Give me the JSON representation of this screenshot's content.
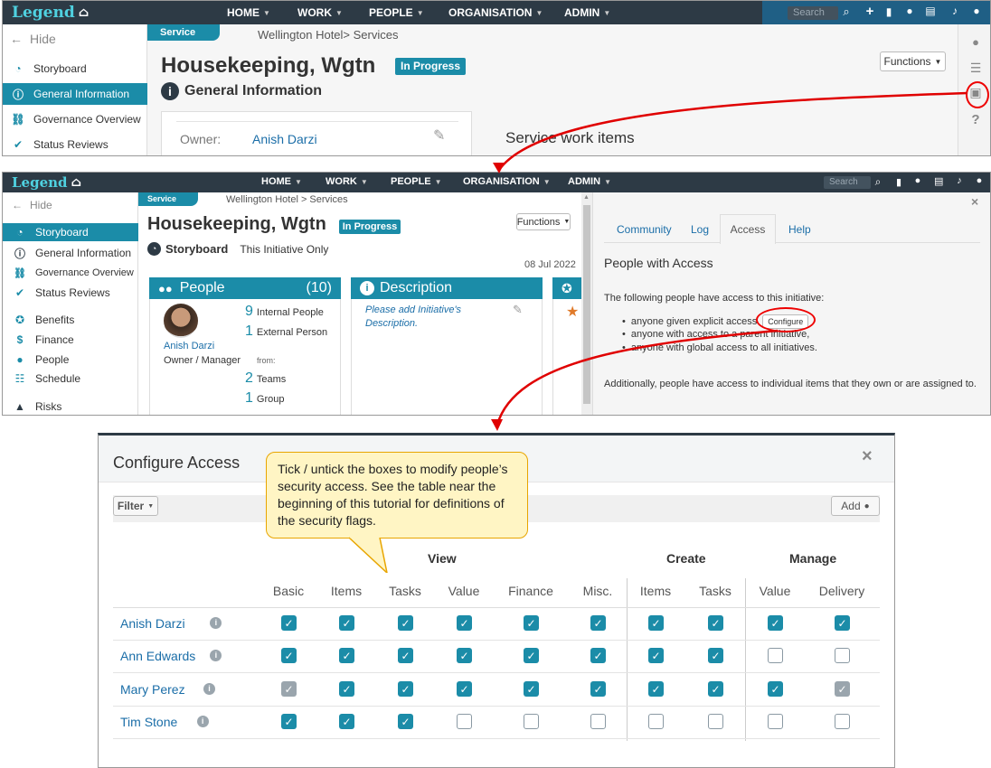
{
  "nav": {
    "brand": "Legend",
    "items": [
      "HOME",
      "WORK",
      "PEOPLE",
      "ORGANISATION",
      "ADMIN"
    ],
    "search_placeholder": "Search"
  },
  "side": {
    "hide": "Hide",
    "items": [
      {
        "label": "Storyboard",
        "icon": "dashboard-icon"
      },
      {
        "label": "General Information",
        "icon": "info-icon"
      },
      {
        "label": "Governance Overview",
        "icon": "governance-icon"
      },
      {
        "label": "Status Reviews",
        "icon": "check-icon"
      },
      {
        "label": "Benefits",
        "icon": "ribbon-icon"
      },
      {
        "label": "Finance",
        "icon": "finance-icon"
      },
      {
        "label": "People",
        "icon": "people-icon"
      },
      {
        "label": "Schedule",
        "icon": "schedule-icon"
      },
      {
        "label": "Risks",
        "icon": "warning-icon"
      }
    ]
  },
  "page": {
    "service_tab": "Service",
    "breadcrumb1": "Wellington Hotel> Services",
    "breadcrumb2": "Wellington Hotel > Services",
    "title": "Housekeeping, Wgtn",
    "status": "In Progress",
    "functions": "Functions",
    "section": "General Information",
    "owner_label": "Owner:",
    "owner_name": "Anish Darzi",
    "work_items": "Service work items",
    "storyboard": "Storyboard",
    "scope": "This Initiative Only",
    "date": "08 Jul 2022"
  },
  "people_card": {
    "title": "People",
    "count": "(10)",
    "person_name": "Anish Darzi",
    "person_role": "Owner / Manager",
    "internal_num": "9",
    "internal_label": "Internal People",
    "external_num": "1",
    "external_label": "External Person",
    "from_label": "from:",
    "teams_num": "2",
    "teams_label": "Teams",
    "group_num": "1",
    "group_label": "Group"
  },
  "desc_card": {
    "title": "Description",
    "placeholder": "Please add Initiative's Description."
  },
  "access_panel": {
    "tabs": [
      "Community",
      "Log",
      "Access",
      "Help"
    ],
    "active_tab": "Access",
    "heading": "People with Access",
    "intro": "The following people have access to this initiative:",
    "bullet1": "anyone given explicit access",
    "configure": "Configure",
    "bullet2": "anyone with access to a parent initiative,",
    "bullet3": "anyone with global access to all initiatives.",
    "footer": "Additionally, people have access to individual items that they own or are assigned to."
  },
  "modal": {
    "title": "Configure Access",
    "filter": "Filter",
    "add": "Add",
    "groups": {
      "view": "View",
      "create": "Create",
      "manage": "Manage"
    },
    "columns": [
      "Basic",
      "Items",
      "Tasks",
      "Value",
      "Finance",
      "Misc.",
      "Items",
      "Tasks",
      "Value",
      "Delivery"
    ],
    "rows": [
      {
        "name": "Anish Darzi",
        "flags": [
          "on",
          "on",
          "on",
          "on",
          "on",
          "on",
          "on",
          "on",
          "on",
          "on"
        ]
      },
      {
        "name": "Ann Edwards",
        "flags": [
          "on",
          "on",
          "on",
          "on",
          "on",
          "on",
          "on",
          "on",
          "off",
          "off"
        ]
      },
      {
        "name": "Mary Perez",
        "flags": [
          "gray",
          "on",
          "on",
          "on",
          "on",
          "on",
          "on",
          "on",
          "on",
          "gray"
        ]
      },
      {
        "name": "Tim Stone",
        "flags": [
          "on",
          "on",
          "on",
          "off",
          "off",
          "off",
          "off",
          "off",
          "off",
          "off"
        ]
      }
    ]
  },
  "callout": {
    "text": "Tick / untick the boxes to modify people’s security access.  See the table near the beginning of this tutorial for definitions of the security flags."
  },
  "colors": {
    "accent": "#1b8ca8",
    "nav": "#2d3a45",
    "annotation": "#e00000",
    "callout_border": "#e8a500"
  }
}
